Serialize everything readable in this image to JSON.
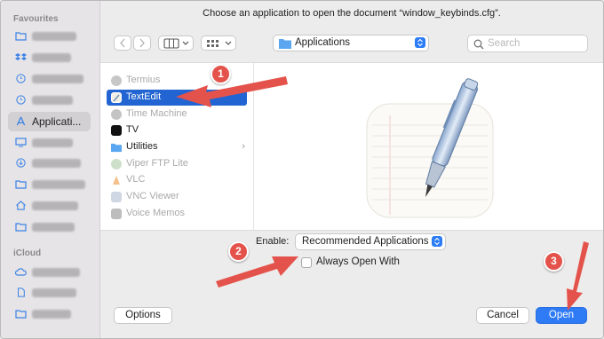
{
  "dialog": {
    "title": "Choose an application to open the document “window_keybinds.cfg”."
  },
  "sidebar": {
    "favourites_title": "Favourites",
    "icloud_title": "iCloud",
    "selected_label": "Applicati..."
  },
  "toolbar": {
    "path_label": "Applications",
    "search_placeholder": "Search"
  },
  "apps": [
    {
      "label": "Termius",
      "state": "dim"
    },
    {
      "label": "TextEdit",
      "state": "selected"
    },
    {
      "label": "Time Machine",
      "state": "dim"
    },
    {
      "label": "TV",
      "state": "normal"
    },
    {
      "label": "Utilities",
      "state": "folder"
    },
    {
      "label": "Viper FTP Lite",
      "state": "dim"
    },
    {
      "label": "VLC",
      "state": "dim"
    },
    {
      "label": "VNC Viewer",
      "state": "dim"
    },
    {
      "label": "Voice Memos",
      "state": "dim"
    }
  ],
  "options": {
    "enable_label": "Enable:",
    "enable_value": "Recommended Applications",
    "always_open_label": "Always Open With"
  },
  "buttons": {
    "options": "Options",
    "cancel": "Cancel",
    "open": "Open"
  },
  "annotations": {
    "badges": [
      "1",
      "2",
      "3"
    ]
  },
  "colors": {
    "accent": "#2264d1",
    "annotation": "#e4534b"
  }
}
